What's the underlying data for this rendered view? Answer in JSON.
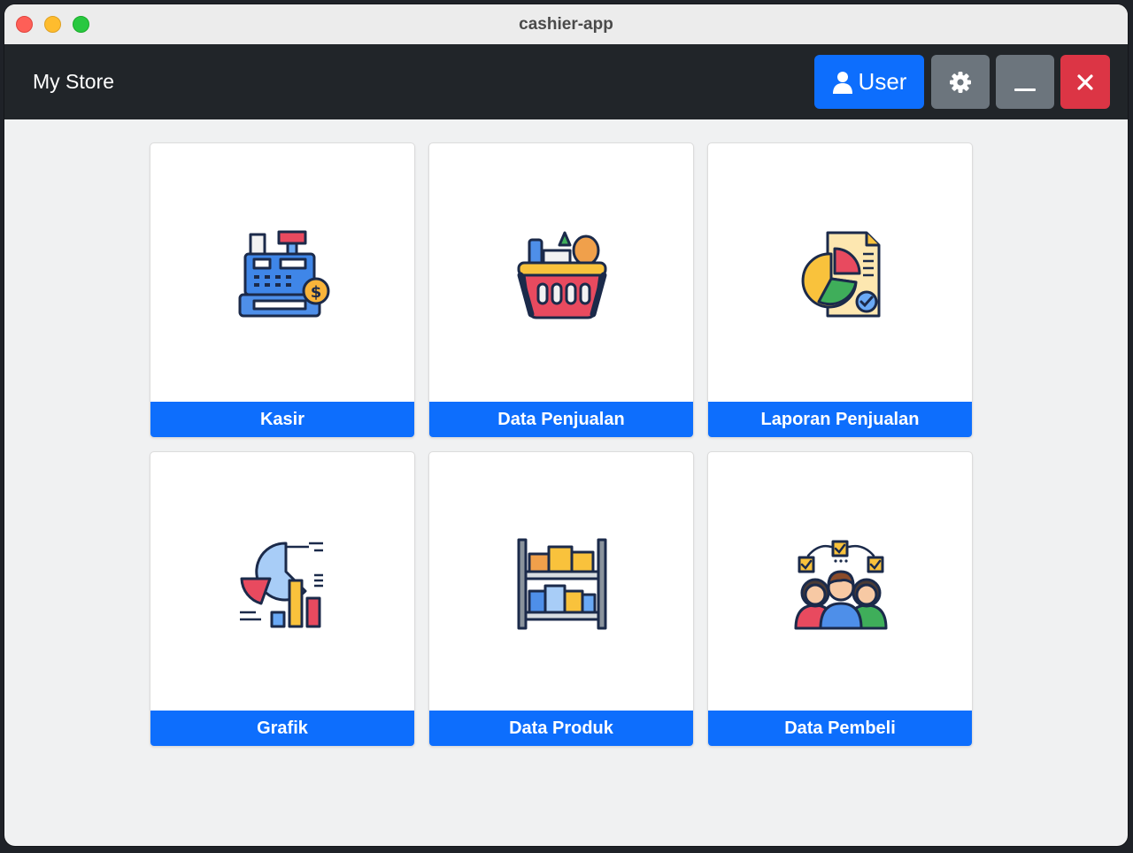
{
  "window": {
    "title": "cashier-app"
  },
  "navbar": {
    "brand": "My Store",
    "user_button": "User",
    "settings_icon": "gear-icon",
    "minimize_icon": "minimize-icon",
    "close_icon": "close-icon"
  },
  "menu": [
    {
      "label": "Kasir",
      "icon": "cash-register-icon"
    },
    {
      "label": "Data Penjualan",
      "icon": "shopping-basket-icon"
    },
    {
      "label": "Laporan Penjualan",
      "icon": "report-chart-icon"
    },
    {
      "label": "Grafik",
      "icon": "chart-icon"
    },
    {
      "label": "Data Produk",
      "icon": "product-shelf-icon"
    },
    {
      "label": "Data Pembeli",
      "icon": "customers-icon"
    }
  ],
  "colors": {
    "primary": "#0d6efd",
    "secondary": "#6c757d",
    "danger": "#dc3545",
    "navbar": "#212529"
  }
}
